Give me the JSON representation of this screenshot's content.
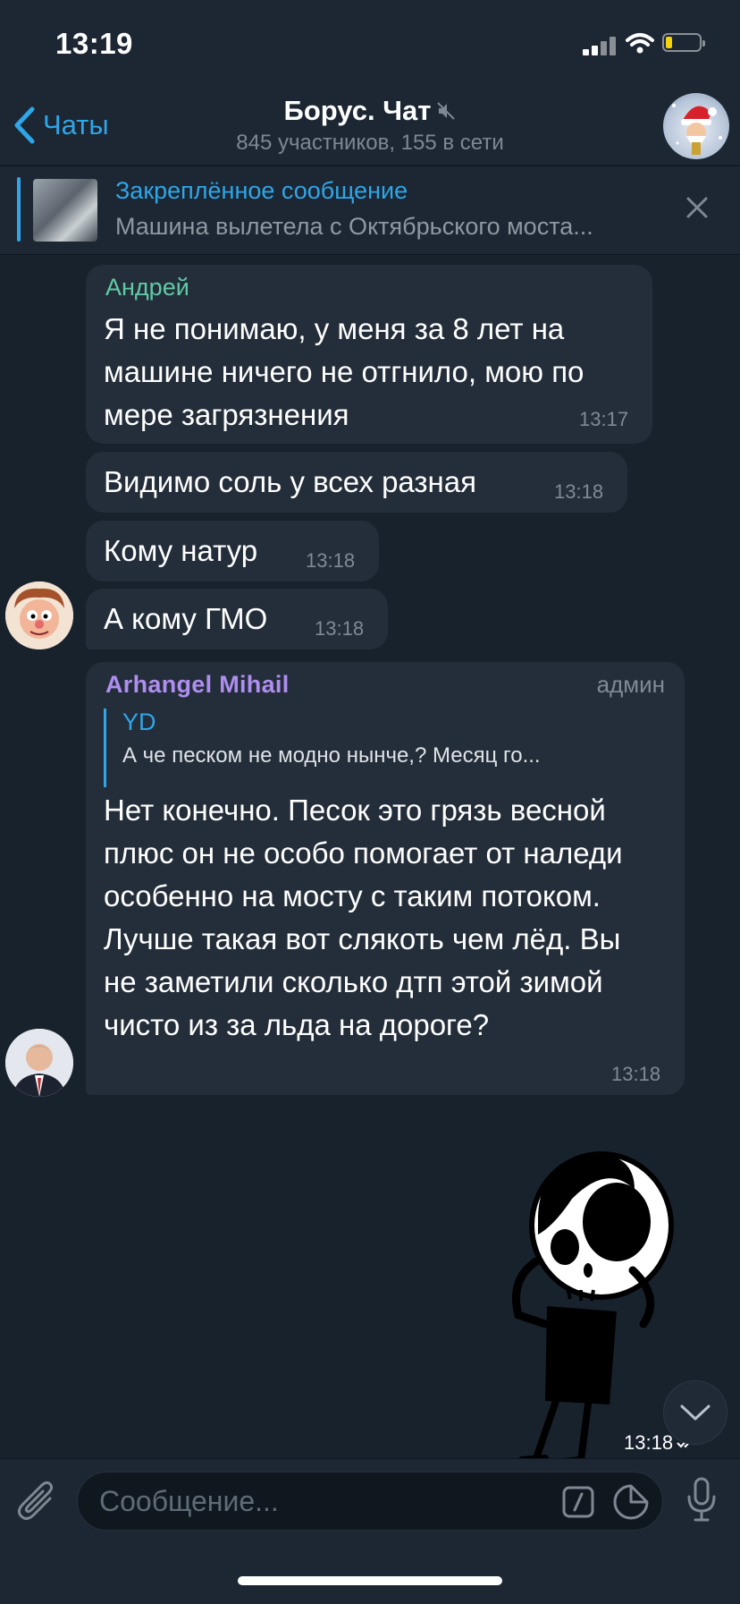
{
  "status_bar": {
    "time": "13:19"
  },
  "header": {
    "back_label": "Чаты",
    "title": "Борус. Чат",
    "subtitle": "845 участников, 155 в сети"
  },
  "pinned": {
    "title": "Закреплённое сообщение",
    "text": "Машина вылетела с Октябрьского моста..."
  },
  "messages": [
    {
      "sender": "Андрей",
      "sender_color": "#62c9a5",
      "text": "Я не понимаю, у меня за 8 лет на машине ничего не отгнило, мою по мере загрязнения",
      "time": "13:17"
    },
    {
      "text": "Видимо соль у всех разная",
      "time": "13:18"
    },
    {
      "text": "Кому натур",
      "time": "13:18"
    },
    {
      "text": "А кому ГМО",
      "time": "13:18"
    },
    {
      "sender": "Arhangel Mihail",
      "sender_color": "#b08ef0",
      "role": "админ",
      "reply": {
        "name": "YD",
        "text": "А че песком не модно нынче,? Месяц го..."
      },
      "text": "Нет конечно. Песок это грязь весной плюс он не особо помогает от наледи особенно на мосту с таким потоком. Лучше такая вот слякоть чем лёд. Вы не заметили сколько дтп этой зимой чисто из за льда на дороге?",
      "time": "13:18"
    }
  ],
  "sticker": {
    "time": "13:18",
    "icon": "double-check-icon"
  },
  "composer": {
    "placeholder": "Сообщение..."
  },
  "colors": {
    "accent": "#2fa6e8",
    "background": "#18222d",
    "bubble": "#232e3a"
  }
}
